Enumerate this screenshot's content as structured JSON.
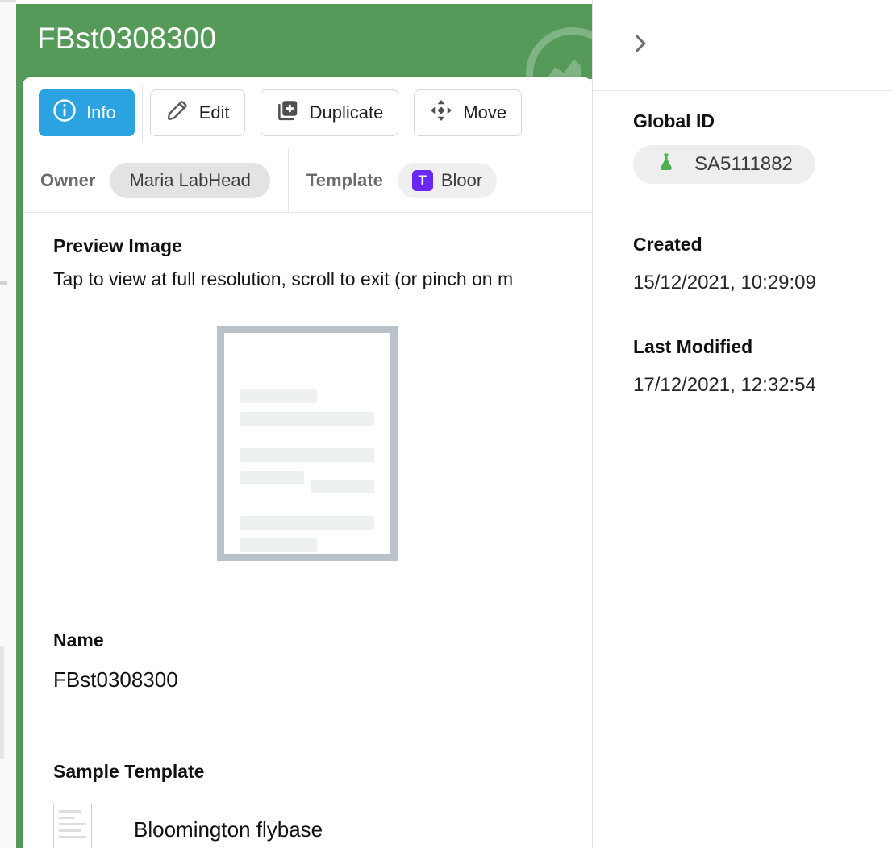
{
  "header": {
    "title": "FBst0308300",
    "background_color": "#559a59",
    "watermark_icon": "mountain-circle-logo"
  },
  "toolbar": {
    "buttons": [
      {
        "label": "Info",
        "icon": "info-circle-icon",
        "active": true,
        "accent_color": "#2aa3e0"
      },
      {
        "label": "Edit",
        "icon": "pencil-icon",
        "active": false
      },
      {
        "label": "Duplicate",
        "icon": "copy-plus-icon",
        "active": false
      },
      {
        "label": "Move",
        "icon": "four-way-arrows-icon",
        "active": false
      }
    ]
  },
  "meta_row": {
    "owner": {
      "label": "Owner",
      "value": "Maria LabHead"
    },
    "template": {
      "label": "Template",
      "value": "Bloor",
      "badge_letter": "T",
      "badge_color": "#6b27f5"
    }
  },
  "main": {
    "preview": {
      "title": "Preview Image",
      "hint": "Tap to view at full resolution, scroll to exit (or pinch on m",
      "placeholder_icon": "document-placeholder-icon"
    },
    "name": {
      "title": "Name",
      "value": "FBst0308300"
    },
    "sample_template": {
      "title": "Sample Template",
      "entry_name": "Bloomington flybase",
      "entry_icon": "document-thumbnail-icon"
    }
  },
  "right_panel": {
    "collapse_icon": "chevron-right-icon",
    "global_id": {
      "label": "Global ID",
      "value": "SA5111882",
      "icon": "flask-icon",
      "icon_color": "#4caf50"
    },
    "created": {
      "label": "Created",
      "value": "15/12/2021, 10:29:09"
    },
    "last_modified": {
      "label": "Last Modified",
      "value": "17/12/2021, 12:32:54"
    }
  }
}
